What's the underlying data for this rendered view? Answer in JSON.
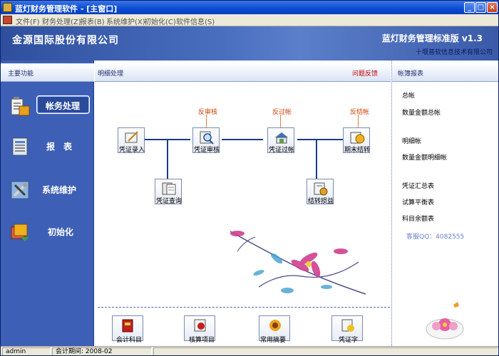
{
  "window": {
    "title": "蓝灯财务管理软件 - [主窗口]"
  },
  "menu": [
    "文件(F)",
    "财务处理(Z)",
    "报表(B)",
    "系统维护(X)",
    "初始化(C)",
    "软件信息(S)"
  ],
  "header": {
    "company": "金源国际股份有限公司",
    "product": "蓝灯财务管理标准版 v1.3",
    "vendor": "十堰普软信息技术有限公司"
  },
  "left": {
    "title": "主要功能",
    "items": [
      {
        "label": "帐务处理",
        "icon": "ledger-icon",
        "active": true
      },
      {
        "label": "报　表",
        "icon": "report-icon",
        "active": false
      },
      {
        "label": "系统维护",
        "icon": "tools-icon",
        "active": false
      },
      {
        "label": "初始化",
        "icon": "init-icon",
        "active": false
      }
    ]
  },
  "center": {
    "title": "明细处理",
    "feedback": "问题反馈",
    "flow": {
      "voucher_entry": "凭证录入",
      "voucher_review": "凭证审核",
      "voucher_post": "凭证过帐",
      "period_close": "期末结转",
      "voucher_query": "凭证查询",
      "profit_transfer": "结转损益",
      "unreview": "反审核",
      "unpost": "反过帐",
      "unclose": "反结帐"
    },
    "bottom": [
      "会计科目",
      "核算项目",
      "常用摘要",
      "凭证字"
    ]
  },
  "right": {
    "title": "帐簿报表",
    "links": [
      "总帐",
      "数量金额总帐",
      "明细帐",
      "数量金额明细帐",
      "凭证汇总表",
      "试算平衡表",
      "科目余额表"
    ],
    "support": "客服QQ：4082555"
  },
  "status": {
    "user": "admin",
    "period": "会计期间: 2008-02"
  },
  "colors": {
    "header": "#3a5aa8",
    "leftpanel": "#3d5fb5",
    "flowline": "#1a3a8c",
    "reverse_label": "#d04000",
    "feedback": "#c00000"
  }
}
